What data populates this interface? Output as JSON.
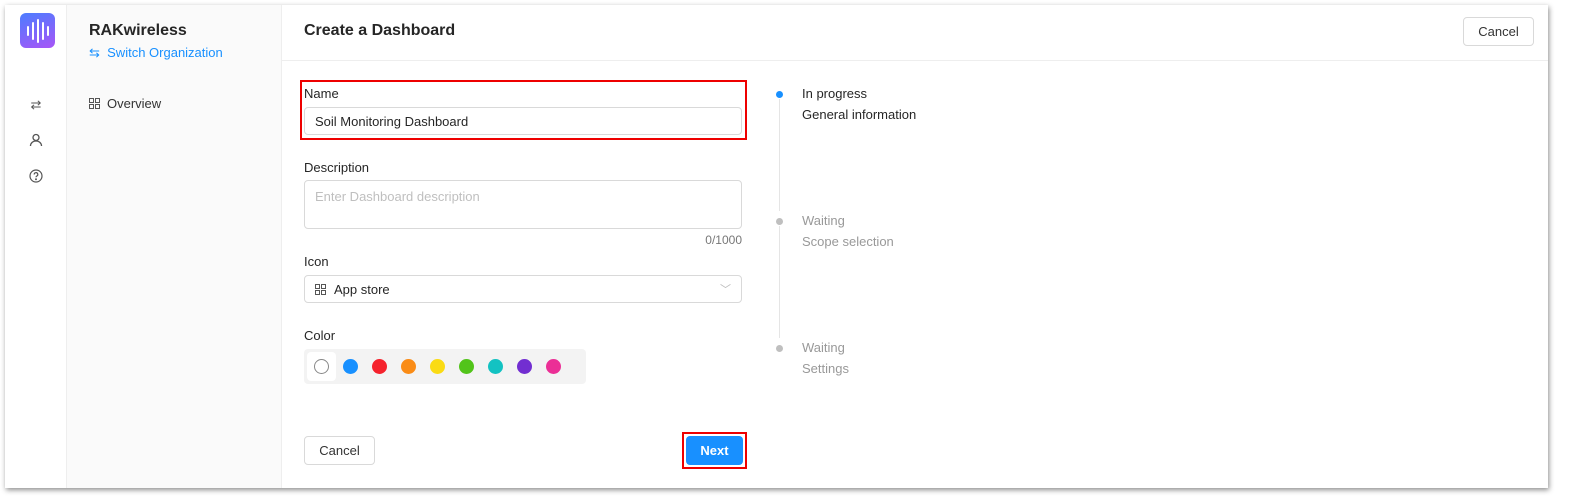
{
  "org": {
    "name": "RAKwireless",
    "switch_label": "Switch Organization"
  },
  "sidebar": {
    "items": [
      {
        "label": "Overview",
        "icon": "grid-icon"
      }
    ]
  },
  "rail": {
    "icons": [
      "repeat-icon",
      "user-icon",
      "help-icon"
    ]
  },
  "header": {
    "title": "Create a Dashboard",
    "cancel_label": "Cancel"
  },
  "form": {
    "name_label": "Name",
    "name_value": "Soil Monitoring Dashboard",
    "description_label": "Description",
    "description_placeholder": "Enter Dashboard description",
    "description_count": "0/1000",
    "icon_label": "Icon",
    "icon_value": "App store",
    "color_label": "Color",
    "colors": [
      "none",
      "#1890ff",
      "#f5222d",
      "#fa8c16",
      "#fadb14",
      "#52c41a",
      "#13c2c2",
      "#722ed1",
      "#eb2f96"
    ],
    "selected_color": "none",
    "cancel_label": "Cancel",
    "next_label": "Next"
  },
  "steps": [
    {
      "status": "In progress",
      "title": "General information",
      "active": true
    },
    {
      "status": "Waiting",
      "title": "Scope selection",
      "active": false
    },
    {
      "status": "Waiting",
      "title": "Settings",
      "active": false
    }
  ]
}
